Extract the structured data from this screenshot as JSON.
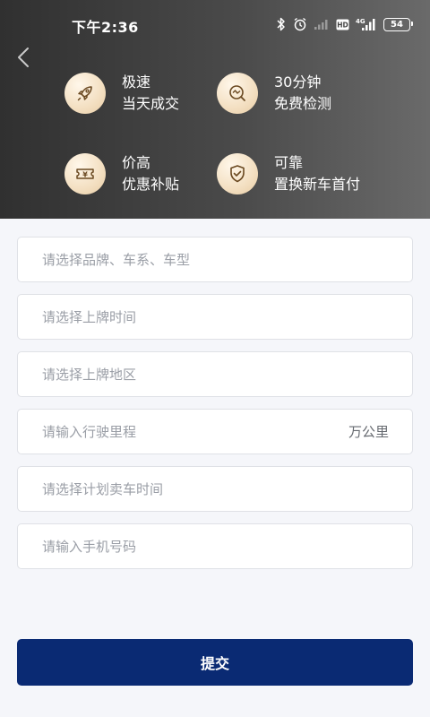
{
  "status_bar": {
    "time": "下午2:36",
    "network": "4G",
    "hd": "HD",
    "battery": "54"
  },
  "header": {
    "features": [
      {
        "icon": "rocket-icon",
        "line1": "极速",
        "line2": "当天成交"
      },
      {
        "icon": "inspection-icon",
        "line1": "30分钟",
        "line2": "免费检测"
      },
      {
        "icon": "yuan-ticket-icon",
        "line1": "价高",
        "line2": "优惠补贴"
      },
      {
        "icon": "shield-check-icon",
        "line1": "可靠",
        "line2": "置换新车首付"
      }
    ],
    "icon_color": "#6b4a22",
    "icon_bg": "#f3dfc1"
  },
  "form": {
    "brand_placeholder": "请选择品牌、车系、车型",
    "reg_time_placeholder": "请选择上牌时间",
    "reg_region_placeholder": "请选择上牌地区",
    "mileage_placeholder": "请输入行驶里程",
    "mileage_unit": "万公里",
    "sell_time_placeholder": "请选择计划卖车时间",
    "phone_placeholder": "请输入手机号码"
  },
  "submit_label": "提交",
  "colors": {
    "primary": "#0a2a73",
    "background": "#f5f6fa",
    "placeholder": "#9a9ea6"
  }
}
